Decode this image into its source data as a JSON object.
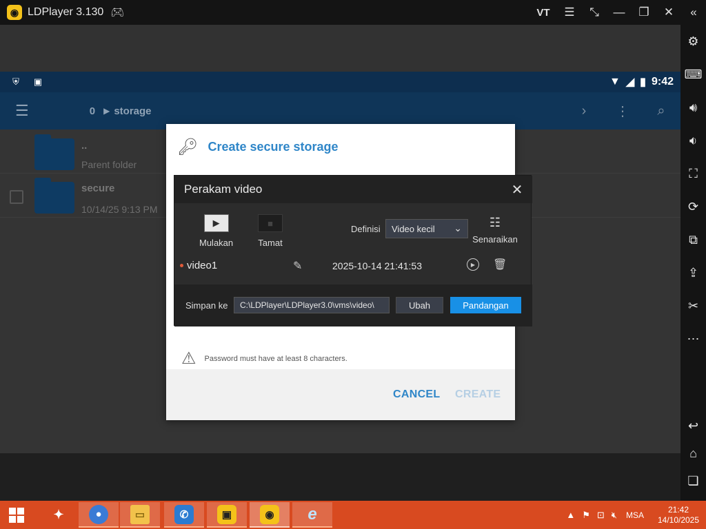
{
  "window": {
    "title": "LDPlayer 3.130",
    "vt_label": "VT"
  },
  "android": {
    "status_time": "9:42",
    "breadcrumb": {
      "count": "0",
      "label": "storage"
    },
    "files": [
      {
        "name": "..",
        "sub": "Parent folder"
      },
      {
        "name": "secure",
        "sub": "10/14/25 9:13 PM"
      }
    ],
    "dialog": {
      "title": "Create secure storage",
      "warning": "Password must have at least 8 characters.",
      "cancel": "CANCEL",
      "create": "CREATE"
    }
  },
  "recorder": {
    "title": "Perakam video",
    "start_label": "Mulakan",
    "stop_label": "Tamat",
    "definition_label": "Definisi",
    "definition_value": "Video kecil",
    "list_label": "Senaraikan",
    "recording": {
      "name": "video1",
      "datetime": "2025-10-14 21:41:53"
    },
    "save_label": "Simpan ke",
    "save_path": "C:\\LDPlayer\\LDPlayer3.0\\vms\\video\\",
    "change_button": "Ubah",
    "view_button": "Pandangan"
  },
  "taskbar": {
    "tray_lang": "MSA",
    "clock_time": "21:42",
    "clock_date": "14/10/2025"
  },
  "colors": {
    "taskbar": "#d84a20",
    "accent_blue": "#2f86c8",
    "primary_button": "#1890e6",
    "status_bar": "#0d2e4f"
  }
}
